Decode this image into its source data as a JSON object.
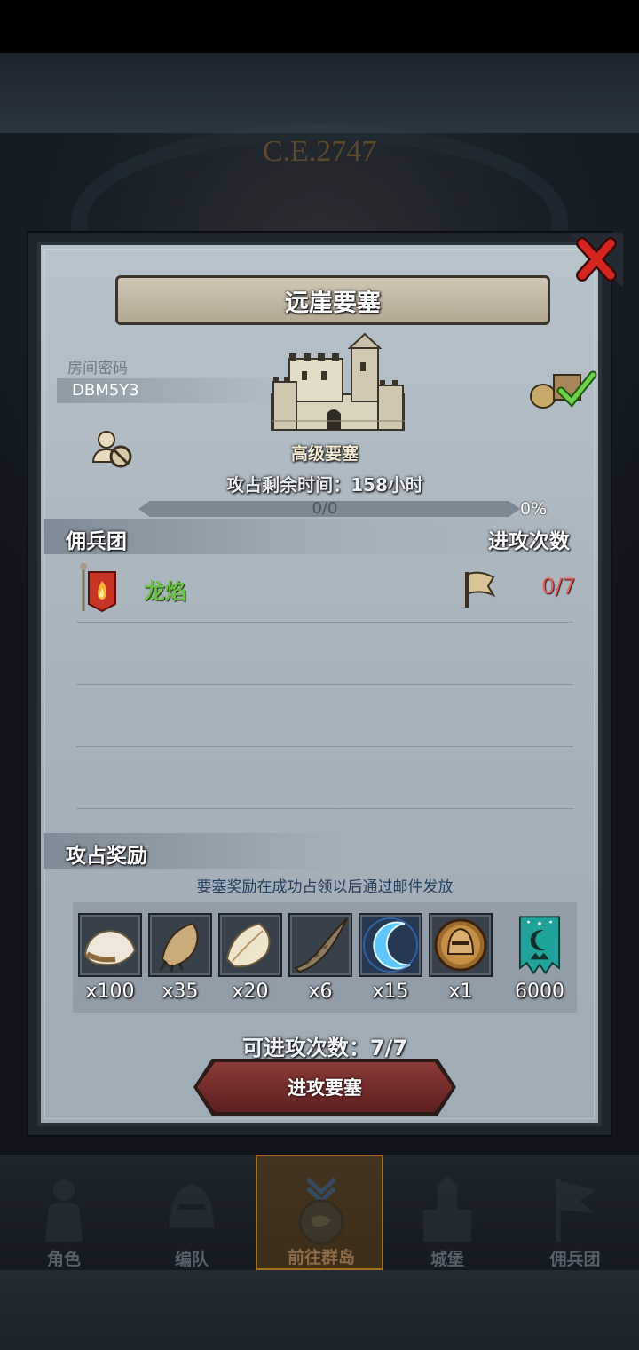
{
  "background": {
    "year": "C.E.2747"
  },
  "modal": {
    "title": "远崖要塞",
    "room_label": "房间密码",
    "room_code": "DBM5Y3",
    "fort_type": "高级要塞",
    "remaining_time": "攻占剩余时间：158小时",
    "progress": {
      "text": "0/0",
      "percent_text": "0%",
      "fraction": 0
    },
    "mercenary_header": "佣兵团",
    "attacks_header": "进攻次数",
    "mercenary_rows": [
      {
        "name": "龙焰",
        "attacks": "0/7"
      }
    ],
    "rewards_header": "攻占奖励",
    "reward_note": "要塞奖励在成功占领以后通过邮件发放",
    "rewards": [
      {
        "icon": "fur-pelt-icon",
        "qty": "x100"
      },
      {
        "icon": "beast-claw-icon",
        "qty": "x35"
      },
      {
        "icon": "feather-hide-icon",
        "qty": "x20"
      },
      {
        "icon": "horn-icon",
        "qty": "x6"
      },
      {
        "icon": "crescent-rune-icon",
        "qty": "x15"
      },
      {
        "icon": "knight-helmet-icon",
        "qty": "x1"
      },
      {
        "icon": "guild-banner-icon",
        "qty": "6000"
      }
    ],
    "available_attacks": "可进攻次数：7/7",
    "attack_button": "进攻要塞"
  },
  "bottom_nav": [
    {
      "label": "角色",
      "icon": "knight-icon",
      "active": false
    },
    {
      "label": "编队",
      "icon": "helmet-formation-icon",
      "active": false
    },
    {
      "label": "前往群岛",
      "icon": "world-compass-icon",
      "active": true
    },
    {
      "label": "城堡",
      "icon": "castle-icon",
      "active": false
    },
    {
      "label": "佣兵团",
      "icon": "mercenary-flag-icon",
      "active": false
    }
  ],
  "colors": {
    "accent_green": "#6cc04a",
    "attack_red": "#e0605e",
    "button_red": "#8b3b38"
  }
}
